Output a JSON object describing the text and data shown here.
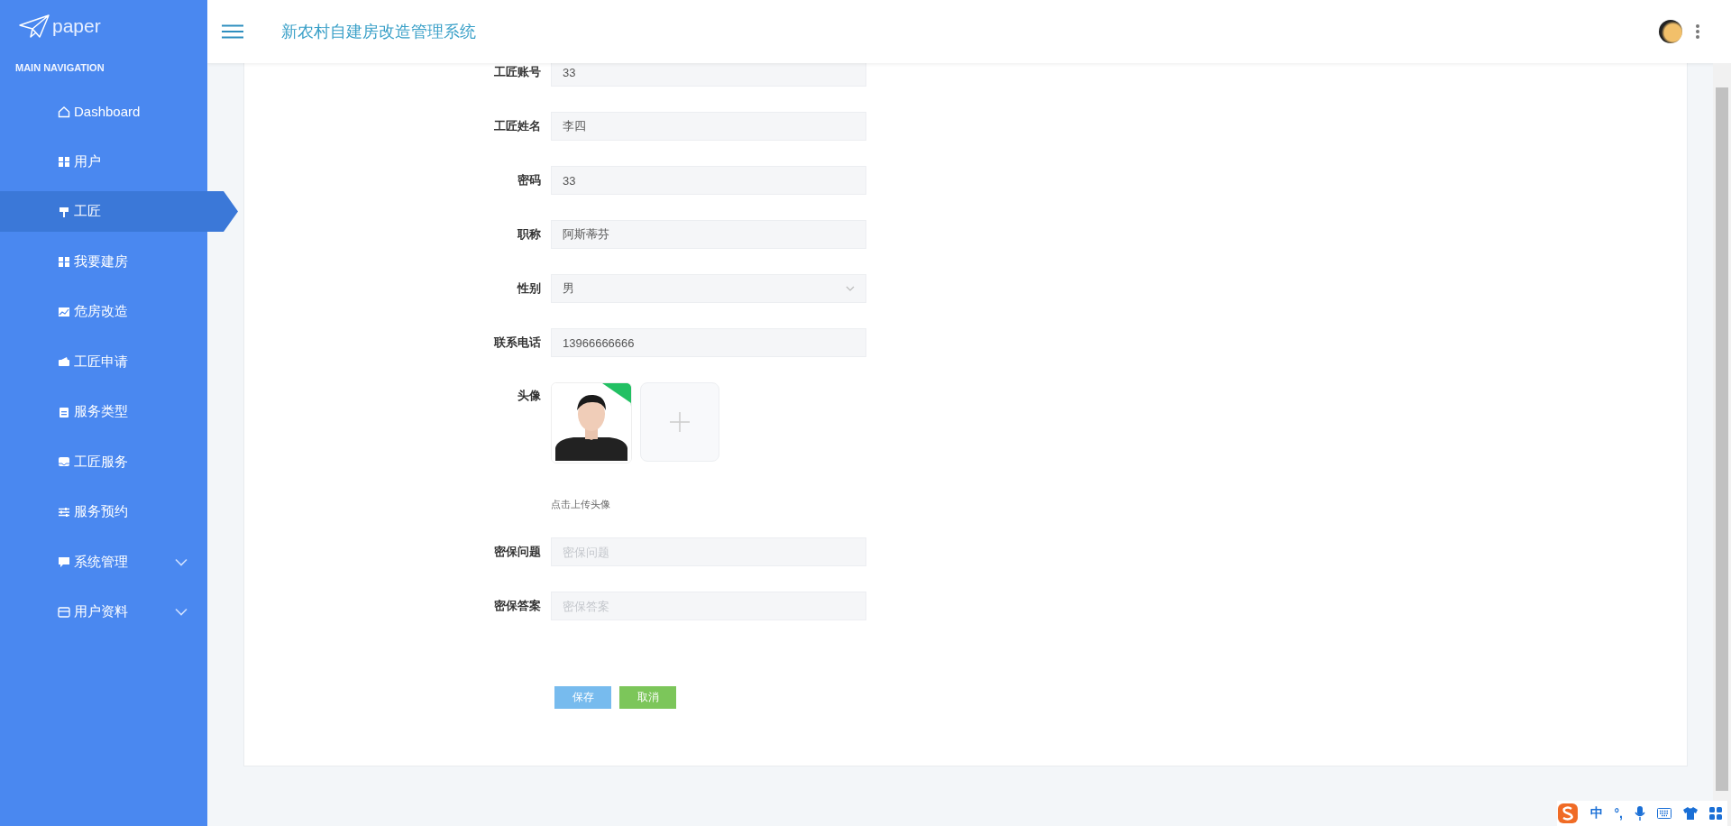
{
  "sidebar": {
    "logo": "paper",
    "section": "MAIN NAVIGATION",
    "items": [
      {
        "label": "Dashboard",
        "kind": "link",
        "selected": false
      },
      {
        "label": "用户",
        "kind": "link",
        "selected": false
      },
      {
        "label": "工匠",
        "kind": "link",
        "selected": true
      },
      {
        "label": "我要建房",
        "kind": "link",
        "selected": false
      },
      {
        "label": "危房改造",
        "kind": "link",
        "selected": false
      },
      {
        "label": "工匠申请",
        "kind": "link",
        "selected": false
      },
      {
        "label": "服务类型",
        "kind": "link",
        "selected": false
      },
      {
        "label": "工匠服务",
        "kind": "link",
        "selected": false
      },
      {
        "label": "服务预约",
        "kind": "link",
        "selected": false
      },
      {
        "label": "系统管理",
        "kind": "group",
        "selected": false
      },
      {
        "label": "用户资料",
        "kind": "group",
        "selected": false
      }
    ]
  },
  "header": {
    "title": "新农村自建房改造管理系统"
  },
  "form": {
    "fields": [
      {
        "label": "工匠账号",
        "kind": "text",
        "value": "33"
      },
      {
        "label": "工匠姓名",
        "kind": "text",
        "value": "李四"
      },
      {
        "label": "密码",
        "kind": "text",
        "value": "33"
      },
      {
        "label": "职称",
        "kind": "text",
        "value": "阿斯蒂芬"
      },
      {
        "label": "性别",
        "kind": "select",
        "value": "男"
      },
      {
        "label": "联系电话",
        "kind": "text",
        "value": "13966666666"
      },
      {
        "label": "头像",
        "kind": "upload",
        "hint": "点击上传头像"
      },
      {
        "label": "密保问题",
        "kind": "text",
        "placeholder": "密保问题"
      },
      {
        "label": "密保答案",
        "kind": "text",
        "placeholder": "密保答案"
      }
    ],
    "buttons": [
      {
        "label": "保存",
        "kind": "primary"
      },
      {
        "label": "取消",
        "kind": "success"
      }
    ]
  },
  "ime_toolbar": {
    "mode": "中",
    "punctuation": "°,"
  }
}
